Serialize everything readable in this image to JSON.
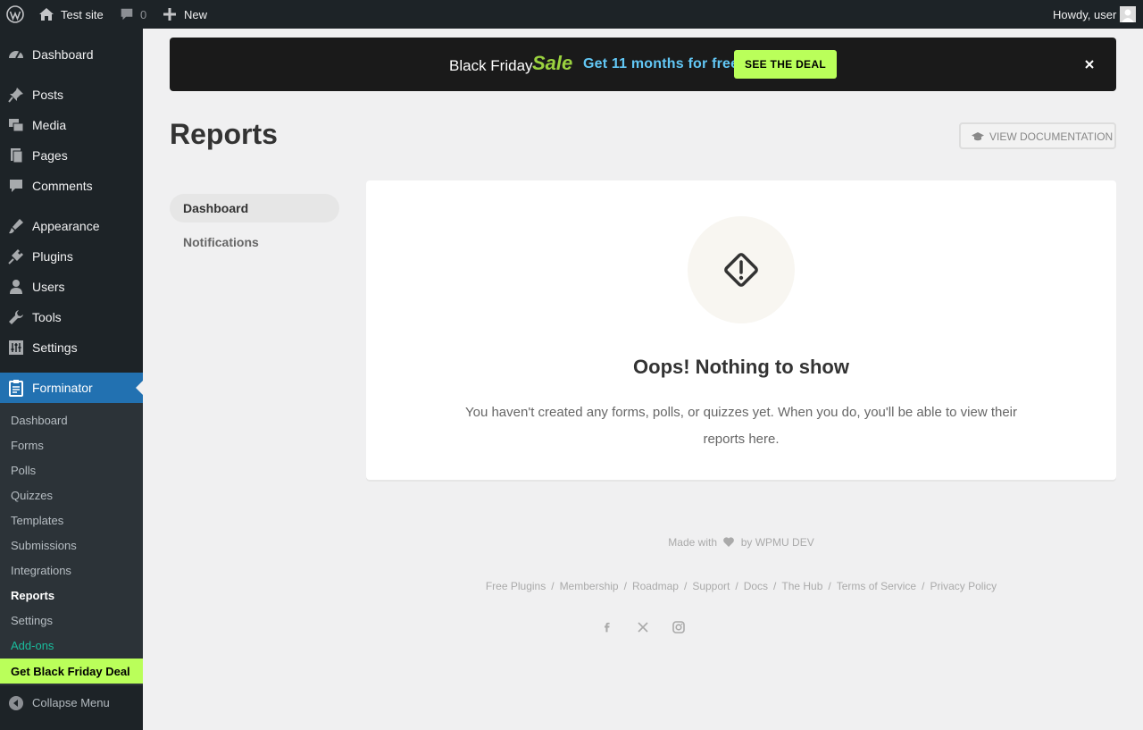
{
  "admin_bar": {
    "site_name": "Test site",
    "comment_count": "0",
    "new_label": "New",
    "greeting": "Howdy, user"
  },
  "sidebar": {
    "items": [
      {
        "label": "Dashboard",
        "icon": "dashboard-icon"
      },
      {
        "label": "Posts",
        "icon": "pin-icon"
      },
      {
        "label": "Media",
        "icon": "media-icon"
      },
      {
        "label": "Pages",
        "icon": "pages-icon"
      },
      {
        "label": "Comments",
        "icon": "comment-icon"
      },
      {
        "label": "Appearance",
        "icon": "brush-icon"
      },
      {
        "label": "Plugins",
        "icon": "plugin-icon"
      },
      {
        "label": "Users",
        "icon": "user-icon"
      },
      {
        "label": "Tools",
        "icon": "wrench-icon"
      },
      {
        "label": "Settings",
        "icon": "settings-icon"
      },
      {
        "label": "Forminator",
        "icon": "clipboard-icon"
      }
    ],
    "submenu": [
      "Dashboard",
      "Forms",
      "Polls",
      "Quizzes",
      "Templates",
      "Submissions",
      "Integrations",
      "Reports",
      "Settings",
      "Add-ons"
    ],
    "deal_label": "Get Black Friday Deal",
    "collapse_label": "Collapse Menu"
  },
  "banner": {
    "text": "Black Friday",
    "sale": "Sale",
    "offer": "Get 11 months for free",
    "button": "SEE THE DEAL"
  },
  "page": {
    "title": "Reports",
    "doc_button": "VIEW DOCUMENTATION",
    "tabs": [
      "Dashboard",
      "Notifications"
    ]
  },
  "empty_state": {
    "title": "Oops! Nothing to show",
    "description": "You haven't created any forms, polls, or quizzes yet. When you do, you'll be able to view their reports here."
  },
  "footer": {
    "made_with": "Made with",
    "by": "by WPMU DEV",
    "links": [
      "Free Plugins",
      "Membership",
      "Roadmap",
      "Support",
      "Docs",
      "The Hub",
      "Terms of Service",
      "Privacy Policy"
    ],
    "social": [
      "facebook-icon",
      "x-icon",
      "instagram-icon"
    ]
  },
  "colors": {
    "admin_dark": "#1d2327",
    "active_blue": "#2271b1",
    "deal_green": "#baff5a",
    "offer_blue": "#62c7f5"
  }
}
